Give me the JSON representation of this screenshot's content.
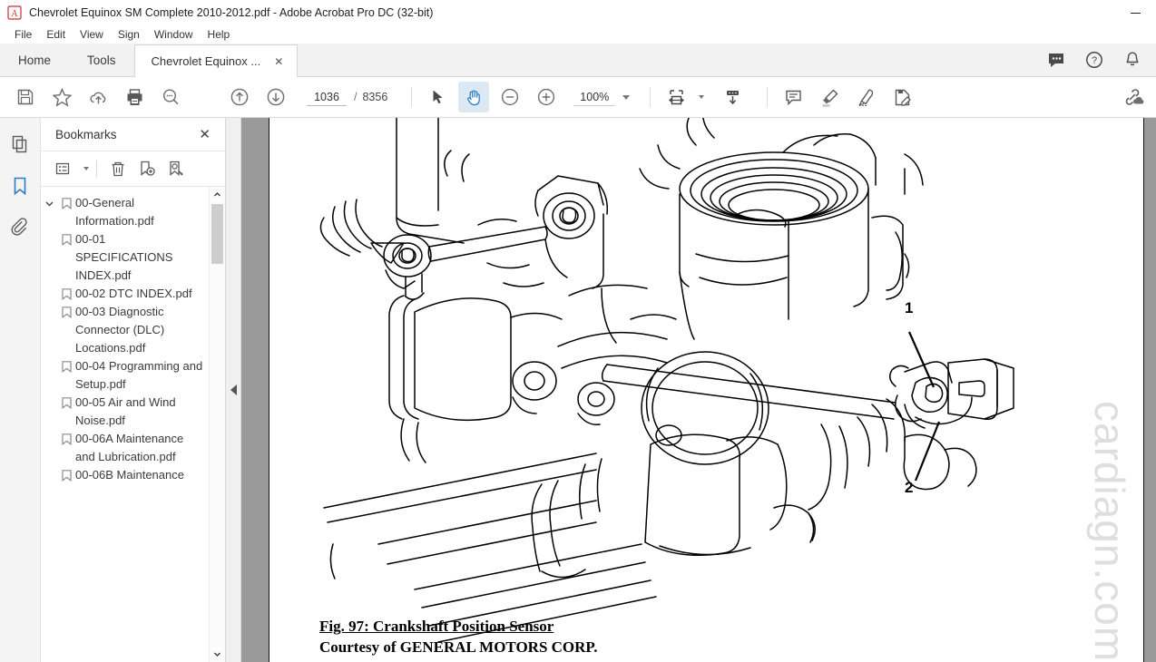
{
  "window": {
    "title": "Chevrolet Equinox SM Complete 2010-2012.pdf - Adobe Acrobat Pro DC (32-bit)",
    "app_icon": "acrobat-icon",
    "minimize_label": "–"
  },
  "menubar": {
    "items": [
      {
        "label": "File"
      },
      {
        "label": "Edit"
      },
      {
        "label": "View"
      },
      {
        "label": "Sign"
      },
      {
        "label": "Window"
      },
      {
        "label": "Help"
      }
    ]
  },
  "tabs": {
    "home_label": "Home",
    "tools_label": "Tools",
    "document_label": "Chevrolet Equinox ...",
    "close_label": "✕",
    "right_icons": [
      {
        "name": "chat-bubble-icon"
      },
      {
        "name": "help-circle-icon"
      },
      {
        "name": "notification-bell-icon"
      }
    ]
  },
  "toolbar": {
    "left_icons": [
      {
        "name": "save-icon"
      },
      {
        "name": "star-icon"
      },
      {
        "name": "cloud-upload-icon"
      },
      {
        "name": "print-icon"
      },
      {
        "name": "search-icon"
      }
    ],
    "prev_page_icon": "arrow-up-circle-icon",
    "next_page_icon": "arrow-down-circle-icon",
    "page_current": "1036",
    "page_separator": "/",
    "page_total": "8356",
    "select_icon": "cursor-arrow-icon",
    "hand_icon": "hand-tool-icon",
    "zoom_out_icon": "zoom-out-icon",
    "zoom_in_icon": "zoom-in-icon",
    "zoom_level": "100%",
    "fit_width_icon": "fit-page-width-icon",
    "scroll_down_icon": "page-scroll-icon",
    "right_icons": [
      {
        "name": "comment-icon"
      },
      {
        "name": "highlighter-icon"
      },
      {
        "name": "draw-pen-icon"
      },
      {
        "name": "fill-and-sign-icon"
      }
    ],
    "share_icon": "share-link-icon",
    "accent_color": "#2b7cc4",
    "active_bg_color": "#dce9f5"
  },
  "rail": {
    "items": [
      {
        "name": "page-thumbnails-icon",
        "active": false
      },
      {
        "name": "bookmarks-icon",
        "active": true
      },
      {
        "name": "attachments-icon",
        "active": false
      }
    ]
  },
  "panel": {
    "title": "Bookmarks",
    "close_label": "✕",
    "tools": [
      {
        "name": "bookmark-options-icon"
      },
      {
        "name": "delete-bookmark-icon"
      },
      {
        "name": "new-bookmark-icon"
      },
      {
        "name": "find-bookmark-icon"
      }
    ],
    "bookmarks": [
      {
        "label": "00-General Information.pdf",
        "level": 0,
        "expanded": true
      },
      {
        "label": "00-01 SPECIFICATIONS INDEX.pdf",
        "level": 1
      },
      {
        "label": "00-02 DTC INDEX.pdf",
        "level": 1
      },
      {
        "label": "00-03 Diagnostic Connector (DLC) Locations.pdf",
        "level": 1
      },
      {
        "label": "00-04 Programming and Setup.pdf",
        "level": 1
      },
      {
        "label": "00-05 Air and Wind Noise.pdf",
        "level": 1
      },
      {
        "label": "00-06A Maintenance and Lubrication.pdf",
        "level": 1
      },
      {
        "label": "00-06B Maintenance",
        "level": 1
      }
    ]
  },
  "document": {
    "watermark": "cardiagn.com",
    "caption_line1": "Fig. 97: Crankshaft Position Sensor",
    "caption_line2": "Courtesy of GENERAL MOTORS CORP.",
    "callouts": [
      {
        "label": "1"
      },
      {
        "label": "2"
      }
    ],
    "figure_name": "crankshaft-position-sensor-line-drawing"
  }
}
